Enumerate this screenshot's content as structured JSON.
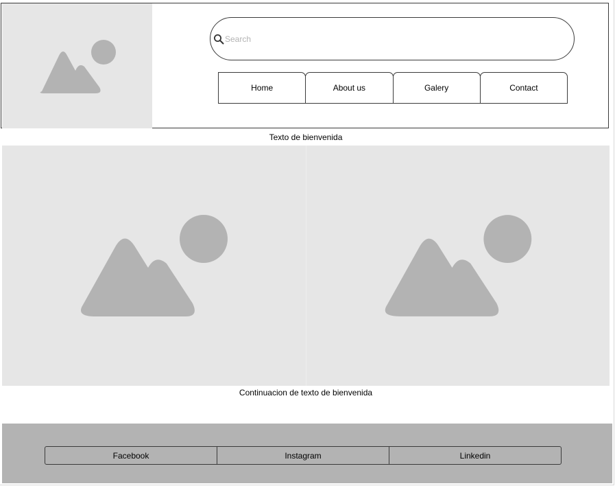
{
  "header": {
    "logo_icon": "image-placeholder-icon",
    "search": {
      "icon": "search-icon",
      "placeholder": "Search",
      "value": ""
    },
    "nav": {
      "items": [
        {
          "label": "Home"
        },
        {
          "label": "About us"
        },
        {
          "label": "Galery"
        },
        {
          "label": "Contact"
        }
      ]
    }
  },
  "main": {
    "welcome_text": "Texto de bienvenida",
    "hero_images": [
      "image-placeholder-icon",
      "image-placeholder-icon"
    ],
    "continuation_text": "Continuacion de texto de bienvenida"
  },
  "footer": {
    "social": [
      {
        "label": "Facebook"
      },
      {
        "label": "Instagram"
      },
      {
        "label": "Linkedin"
      }
    ]
  },
  "colors": {
    "placeholder_bg": "#e6e6e6",
    "placeholder_shape": "#b3b3b3",
    "footer_bg": "#b3b3b3",
    "border": "#3a3a3a"
  }
}
